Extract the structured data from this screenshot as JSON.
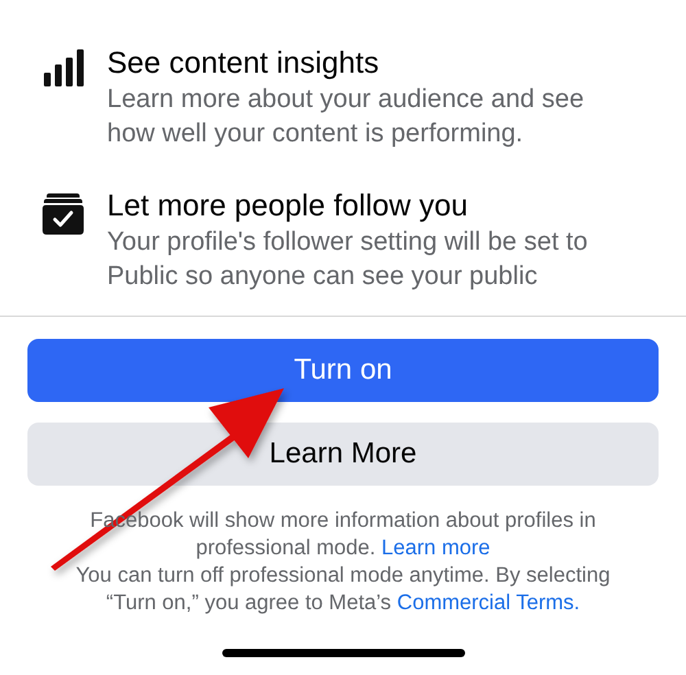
{
  "features": [
    {
      "kind": "insights",
      "title": "See content insights",
      "description": "Learn more about your audience and see how well your content is performing."
    },
    {
      "kind": "follow",
      "title": "Let more people follow you",
      "description": "Your profile's follower setting will be set to Public so anyone can see your public"
    }
  ],
  "buttons": [
    {
      "kind": "primary",
      "label": "Turn on"
    },
    {
      "kind": "secondary",
      "label": "Learn More"
    }
  ],
  "notes": [
    {
      "text": "Facebook will show more information about profiles in professional mode.",
      "link": "Learn more"
    },
    {
      "text": "You can turn off professional mode anytime. By selecting “Turn on,” you agree to Meta’s",
      "link": "Commercial Terms."
    }
  ]
}
